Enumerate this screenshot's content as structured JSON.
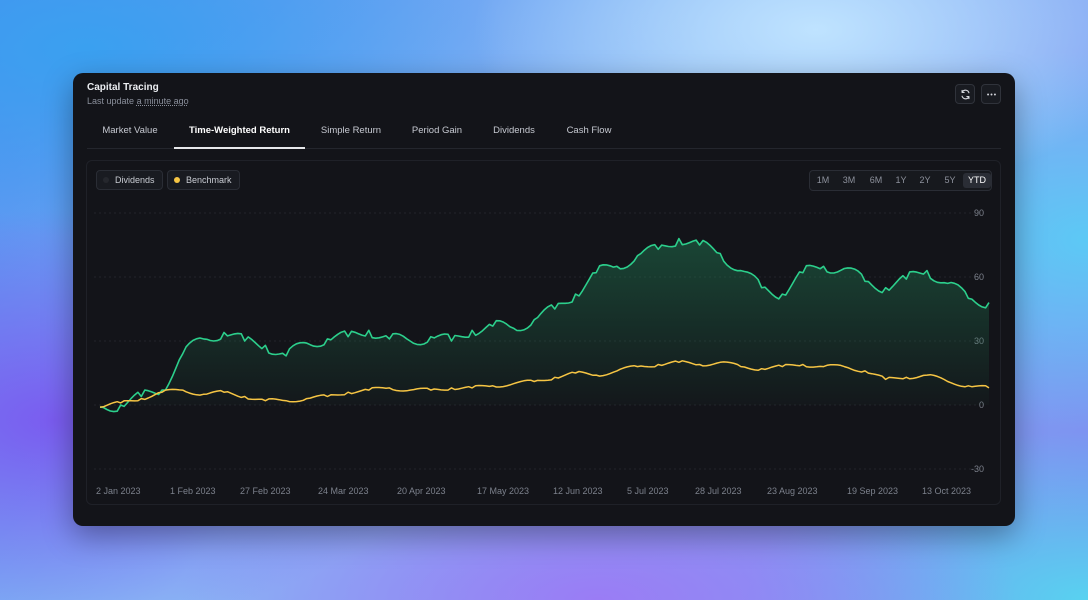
{
  "card": {
    "title": "Capital Tracing",
    "subtitle_prefix": "Last update",
    "subtitle_ago": "a minute ago"
  },
  "icons": {
    "refresh": "refresh-icon",
    "more": "more-horizontal-icon"
  },
  "tabs": [
    {
      "label": "Market Value"
    },
    {
      "label": "Time-Weighted Return",
      "active": true
    },
    {
      "label": "Simple Return"
    },
    {
      "label": "Period Gain"
    },
    {
      "label": "Dividends"
    },
    {
      "label": "Cash Flow"
    }
  ],
  "ranges": [
    {
      "label": "1M"
    },
    {
      "label": "3M"
    },
    {
      "label": "6M"
    },
    {
      "label": "1Y"
    },
    {
      "label": "2Y"
    },
    {
      "label": "5Y"
    },
    {
      "label": "YTD",
      "active": true
    }
  ],
  "colors": {
    "primary_line": "#2ccf8c",
    "benchmark_line": "#f6c544",
    "legend_dividends_dot": "#25272d",
    "grid": "#23252c"
  },
  "chart_data": {
    "type": "line",
    "title": "",
    "xlabel": "",
    "ylabel": "",
    "ylim": [
      -30,
      90
    ],
    "y_ticks": [
      90,
      60,
      30,
      0,
      -30
    ],
    "x_ticks": [
      "2 Jan 2023",
      "1 Feb 2023",
      "27 Feb 2023",
      "24 Mar 2023",
      "20 Apr 2023",
      "17 May 2023",
      "12 Jun 2023",
      "5 Jul 2023",
      "28 Jul 2023",
      "23 Aug 2023",
      "19 Sep 2023",
      "13 Oct 2023"
    ],
    "legend": [
      "Dividends",
      "Benchmark"
    ],
    "legend_position": "top-left",
    "grid": true,
    "x": [
      "2023-01-02",
      "2023-01-09",
      "2023-01-16",
      "2023-01-23",
      "2023-01-30",
      "2023-02-06",
      "2023-02-13",
      "2023-02-20",
      "2023-02-27",
      "2023-03-06",
      "2023-03-13",
      "2023-03-20",
      "2023-03-27",
      "2023-04-03",
      "2023-04-10",
      "2023-04-17",
      "2023-04-24",
      "2023-05-01",
      "2023-05-08",
      "2023-05-15",
      "2023-05-22",
      "2023-05-29",
      "2023-06-05",
      "2023-06-12",
      "2023-06-19",
      "2023-06-26",
      "2023-07-03",
      "2023-07-10",
      "2023-07-17",
      "2023-07-24",
      "2023-07-31",
      "2023-08-07",
      "2023-08-14",
      "2023-08-21",
      "2023-08-28",
      "2023-09-04",
      "2023-09-11",
      "2023-09-18",
      "2023-09-25",
      "2023-10-02",
      "2023-10-09",
      "2023-10-16",
      "2023-10-23",
      "2023-10-30"
    ],
    "series": [
      {
        "name": "",
        "values": [
          -1,
          0,
          4,
          7,
          24,
          31,
          34,
          30,
          28,
          23,
          29,
          31,
          32,
          35,
          31,
          30,
          32,
          30,
          35,
          37,
          36,
          40,
          45,
          52,
          62,
          65,
          70,
          73,
          78,
          75,
          71,
          63,
          55,
          52,
          62,
          65,
          64,
          58,
          55,
          59,
          63,
          57,
          50,
          48
        ]
      },
      {
        "name": "Benchmark",
        "values": [
          -1,
          1,
          3,
          6,
          7,
          5,
          6,
          4,
          2,
          2,
          3,
          4,
          6,
          7,
          8,
          7,
          7,
          8,
          8,
          9,
          10,
          11,
          13,
          15,
          14,
          16,
          18,
          19,
          20,
          19,
          20,
          18,
          17,
          18,
          19,
          18,
          18,
          16,
          12,
          13,
          14,
          11,
          9,
          8
        ]
      }
    ]
  }
}
